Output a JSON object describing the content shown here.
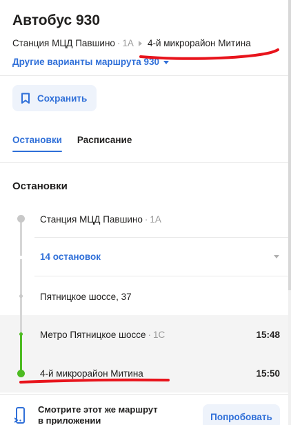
{
  "header": {
    "title": "Автобус 930",
    "route_from": "Станция МЦД Павшино",
    "route_from_code": "1А",
    "route_to": "4-й микрорайон Митина",
    "other_variants": "Другие варианты маршрута 930"
  },
  "actions": {
    "save_label": "Сохранить"
  },
  "tabs": [
    {
      "label": "Остановки",
      "active": true
    },
    {
      "label": "Расписание",
      "active": false
    }
  ],
  "stops_section": {
    "title": "Остановки",
    "collapsed_label": "14 остановок",
    "stops": [
      {
        "name": "Станция МЦД Павшино",
        "code": "1А",
        "time": ""
      },
      {
        "name": "Пятницкое шоссе, 37",
        "code": "",
        "time": ""
      },
      {
        "name": "Метро Пятницкое шоссе",
        "code": "1С",
        "time": "15:48"
      },
      {
        "name": "4-й микрорайон Митина",
        "code": "",
        "time": "15:50"
      }
    ]
  },
  "promo": {
    "line1": "Смотрите этот же маршрут",
    "line2": "в приложении",
    "button": "Попробовать"
  },
  "colors": {
    "accent": "#2f6fd8",
    "route_green": "#4dbb22",
    "annotation_red": "#e8141c"
  }
}
